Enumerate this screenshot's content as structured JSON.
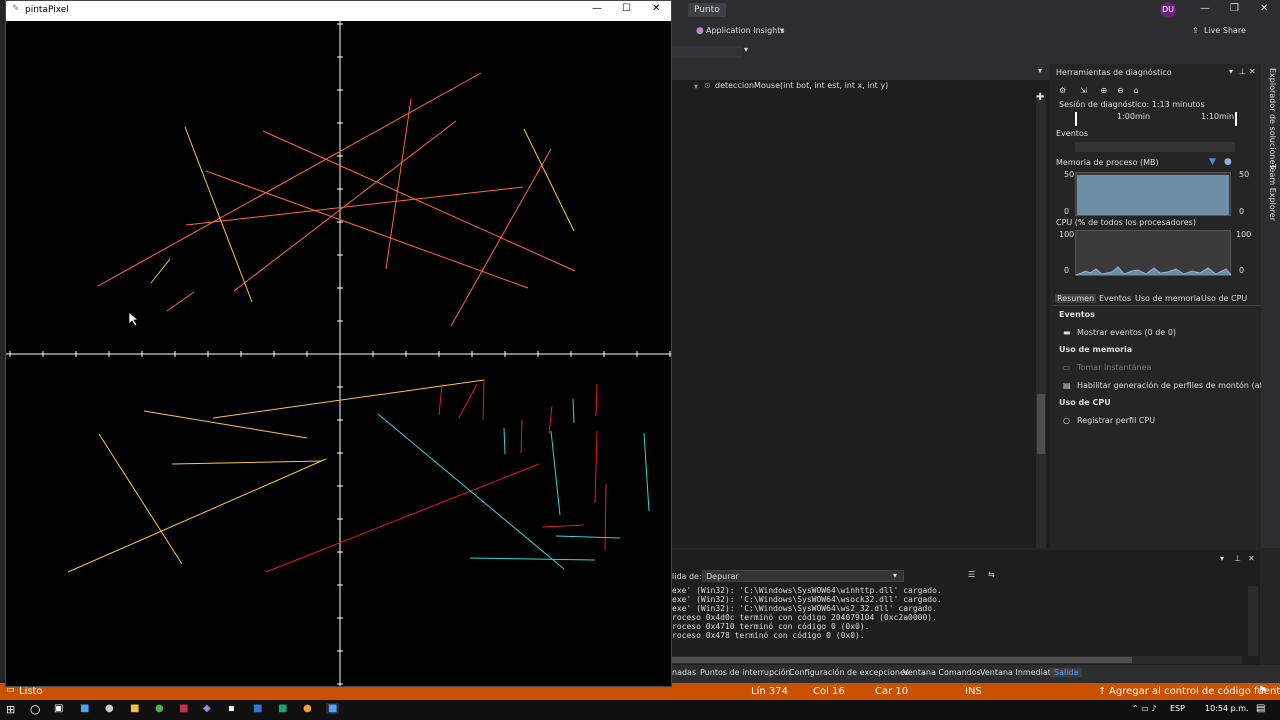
{
  "pinta": {
    "title": "pintaPixel",
    "controls": [
      "—",
      "☐",
      "✕"
    ],
    "drawing": {
      "background": "#000000",
      "axis_color": "#ffffff",
      "lines": [
        {
          "c": "#ff6a3d",
          "p": [
            [
              97,
              285
            ],
            [
              480,
              72
            ]
          ]
        },
        {
          "c": "#ff6a3d",
          "p": [
            [
              262,
              130
            ],
            [
              574,
              270
            ]
          ]
        },
        {
          "c": "#ff6a3d",
          "p": [
            [
              185,
              224
            ],
            [
              522,
              186
            ]
          ]
        },
        {
          "c": "#ff6a3d",
          "p": [
            [
              205,
              170
            ],
            [
              527,
              287
            ]
          ]
        },
        {
          "c": "#ff6a3d",
          "p": [
            [
              233,
              290
            ],
            [
              455,
              120
            ]
          ]
        },
        {
          "c": "#ff6a3d",
          "p": [
            [
              385,
              268
            ],
            [
              410,
              98
            ]
          ]
        },
        {
          "c": "#ff6a3d",
          "p": [
            [
              450,
              325
            ],
            [
              550,
              148
            ]
          ]
        },
        {
          "c": "#ff6a3d",
          "p": [
            [
              166,
              310
            ],
            [
              193,
              291
            ]
          ]
        },
        {
          "c": "#ffc640",
          "p": [
            [
              184,
              126
            ],
            [
              251,
              301
            ]
          ]
        },
        {
          "c": "#ffc640",
          "p": [
            [
              150,
              282
            ],
            [
              169,
              258
            ]
          ]
        },
        {
          "c": "#ffc640",
          "p": [
            [
              523,
              128
            ],
            [
              573,
              230
            ]
          ]
        },
        {
          "c": "#ffc640",
          "p": [
            [
              212,
              417
            ],
            [
              483,
              379
            ]
          ]
        },
        {
          "c": "#ffc640",
          "p": [
            [
              143,
              410
            ],
            [
              306,
              437
            ]
          ]
        },
        {
          "c": "#ffc640",
          "p": [
            [
              98,
              433
            ],
            [
              181,
              563
            ]
          ]
        },
        {
          "c": "#ffc640",
          "p": [
            [
              67,
              571
            ],
            [
              325,
              458
            ]
          ]
        },
        {
          "c": "#ffc640",
          "p": [
            [
              171,
              463
            ],
            [
              321,
              460
            ]
          ]
        },
        {
          "c": "#e02020",
          "p": [
            [
              265,
              571
            ],
            [
              538,
              463
            ]
          ]
        },
        {
          "c": "#e02020",
          "p": [
            [
              438,
              414
            ],
            [
              441,
              383
            ]
          ]
        },
        {
          "c": "#e02020",
          "p": [
            [
              458,
              417
            ],
            [
              476,
              383
            ]
          ]
        },
        {
          "c": "#e02020",
          "p": [
            [
              482,
              419
            ],
            [
              483,
              379
            ]
          ]
        },
        {
          "c": "#e02020",
          "p": [
            [
              520,
              452
            ],
            [
              521,
              419
            ]
          ]
        },
        {
          "c": "#e02020",
          "p": [
            [
              548,
              433
            ],
            [
              551,
              405
            ]
          ]
        },
        {
          "c": "#e02020",
          "p": [
            [
              595,
              415
            ],
            [
              596,
              383
            ]
          ]
        },
        {
          "c": "#e02020",
          "p": [
            [
              594,
              502
            ],
            [
              596,
              430
            ]
          ]
        },
        {
          "c": "#e02020",
          "p": [
            [
              604,
              549
            ],
            [
              605,
              483
            ]
          ]
        },
        {
          "c": "#e02020",
          "p": [
            [
              541,
              526
            ],
            [
              583,
              524
            ]
          ]
        },
        {
          "c": "#3ad4d4",
          "p": [
            [
              377,
              413
            ],
            [
              563,
              568
            ]
          ]
        },
        {
          "c": "#3ad4d4",
          "p": [
            [
              550,
              430
            ],
            [
              559,
              514
            ]
          ]
        },
        {
          "c": "#3ad4d4",
          "p": [
            [
              503,
              427
            ],
            [
              504,
              453
            ]
          ]
        },
        {
          "c": "#3ad4d4",
          "p": [
            [
              572,
              398
            ],
            [
              573,
              422
            ]
          ]
        },
        {
          "c": "#3ad4d4",
          "p": [
            [
              643,
              432
            ],
            [
              648,
              510
            ]
          ]
        },
        {
          "c": "#3ad4d4",
          "p": [
            [
              555,
              535
            ],
            [
              619,
              537
            ]
          ]
        },
        {
          "c": "#3ad4d4",
          "p": [
            [
              469,
              557
            ],
            [
              594,
              559
            ]
          ]
        }
      ]
    }
  },
  "vs": {
    "title_tab": "Punto",
    "user_initials": "DU",
    "app_insights": "Application Insights",
    "live_share": "Live Share",
    "method_signature": "deteccionMouse(int bot, int est, int x, int y)",
    "diag": {
      "title": "Herramientas de diagnóstico",
      "session": "Sesión de diagnóstico: 1:13 minutos",
      "timeline": [
        "1:00min",
        "1:10min"
      ],
      "events_label": "Eventos",
      "mem_label": "Memoria de proceso (MB)",
      "mem_max": "50",
      "mem_min": "0",
      "cpu_label": "CPU (% de todos los procesadores)",
      "cpu_max": "100",
      "cpu_min": "0",
      "tabs": [
        "Resumen",
        "Eventos",
        "Uso de memoria",
        "Uso de CPU"
      ],
      "sec_eventos": "Eventos",
      "show_events": "Mostrar eventos (0 de 0)",
      "sec_memory": "Uso de memoria",
      "snapshot": "Tomar instantánea",
      "heap_profile": "Habilitar generación de perfiles de montón (afect",
      "sec_cpu": "Uso de CPU",
      "cpu_profile": "Registrar perfil CPU"
    },
    "side_rail": [
      "Explorador de soluciones",
      "Team Explorer"
    ],
    "output": {
      "show_from_label": "lida de:",
      "show_from_value": "Depurar",
      "lines": [
        "exe' (Win32): 'C:\\Windows\\SysWOW64\\winhttp.dll' cargado.",
        "exe' (Win32): 'C:\\Windows\\SysWOW64\\wsock32.dll' cargado.",
        "exe' (Win32): 'C:\\Windows\\SysWOW64\\ws2_32.dll' cargado.",
        "roceso 0x4d0c terminó con código 204079104 (0xc2a0000).",
        "roceso 0x4710 terminó con código 0 (0x0).",
        "roceso 0x478 terminó con código 0 (0x0)."
      ]
    },
    "bottom_tabs": [
      "nadas",
      "Puntos de interrupción",
      "Configuración de excepciones",
      "Ventana Comandos",
      "Ventana Inmediato",
      "Salida"
    ],
    "status": {
      "ready": "Listo",
      "line": "Lín 374",
      "col": "Col 16",
      "car": "Car 10",
      "ins": "INS",
      "source_control": "Agregar al control de código fuente"
    }
  },
  "taskbar": {
    "lang": "ESP",
    "time": "10:54 p.m."
  }
}
